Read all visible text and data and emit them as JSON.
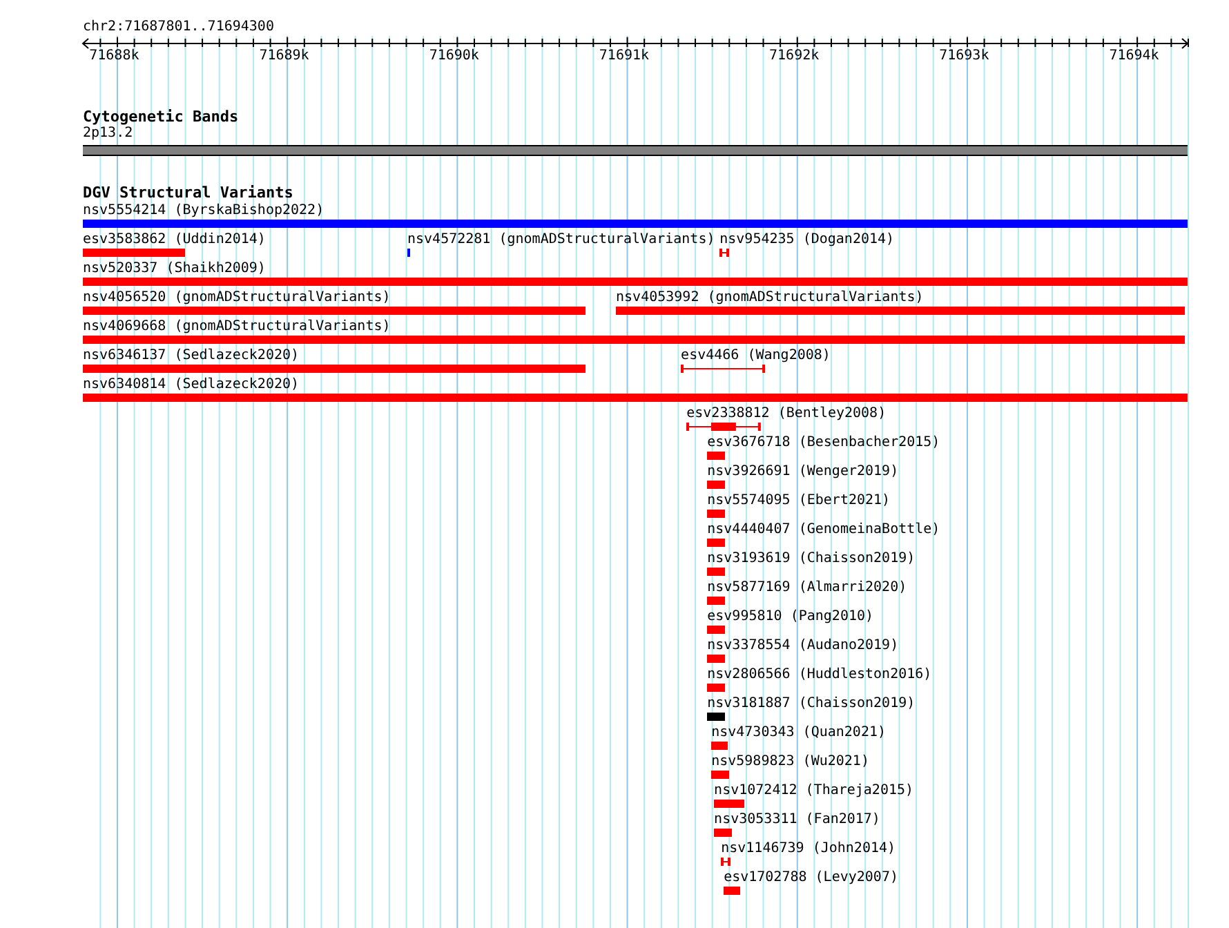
{
  "ruler": {
    "title": "chr2:71687801..71694300",
    "ticks": [
      {
        "label": "71688k"
      },
      {
        "label": "71689k"
      },
      {
        "label": "71690k"
      },
      {
        "label": "71691k"
      },
      {
        "label": "71692k"
      },
      {
        "label": "71693k"
      },
      {
        "label": "71694k"
      }
    ]
  },
  "cytoband_track": {
    "title": "Cytogenetic Bands",
    "band": {
      "label": "2p13.2",
      "color": "#808080"
    }
  },
  "variant_track": {
    "title": "DGV Structural Variants",
    "rows": [
      {
        "features": [
          {
            "label": "nsv5554214 (ByrskaBishop2022)",
            "kind": "bar",
            "color": "#0000ff"
          }
        ]
      },
      {
        "features": [
          {
            "label": "esv3583862 (Uddin2014)",
            "kind": "bar",
            "color": "#ff0000"
          },
          {
            "label": "nsv4572281 (gnomADStructuralVariants)",
            "kind": "bar",
            "color": "#0000ff"
          },
          {
            "label": "nsv954235 (Dogan2014)",
            "kind": "interval",
            "color": "#ff0000"
          }
        ]
      },
      {
        "features": [
          {
            "label": "nsv520337 (Shaikh2009)",
            "kind": "bar",
            "color": "#ff0000"
          }
        ]
      },
      {
        "features": [
          {
            "label": "nsv4056520 (gnomADStructuralVariants)",
            "kind": "bar",
            "color": "#ff0000"
          },
          {
            "label": "nsv4053992 (gnomADStructuralVariants)",
            "kind": "bar",
            "color": "#ff0000"
          }
        ]
      },
      {
        "features": [
          {
            "label": "nsv4069668 (gnomADStructuralVariants)",
            "kind": "bar",
            "color": "#ff0000"
          }
        ]
      },
      {
        "features": [
          {
            "label": "nsv6346137 (Sedlazeck2020)",
            "kind": "bar",
            "color": "#ff0000"
          },
          {
            "label": "esv4466 (Wang2008)",
            "kind": "interval",
            "color": "#ff0000"
          }
        ]
      },
      {
        "features": [
          {
            "label": "nsv6340814 (Sedlazeck2020)",
            "kind": "bar",
            "color": "#ff0000"
          }
        ]
      },
      {
        "features": [
          {
            "label": "esv2338812 (Bentley2008)",
            "kind": "interval",
            "color": "#ff0000"
          }
        ]
      },
      {
        "features": [
          {
            "label": "esv3676718 (Besenbacher2015)",
            "kind": "bar",
            "color": "#ff0000"
          }
        ]
      },
      {
        "features": [
          {
            "label": "nsv3926691 (Wenger2019)",
            "kind": "bar",
            "color": "#ff0000"
          }
        ]
      },
      {
        "features": [
          {
            "label": "nsv5574095 (Ebert2021)",
            "kind": "bar",
            "color": "#ff0000"
          }
        ]
      },
      {
        "features": [
          {
            "label": "nsv4440407 (GenomeinaBottle)",
            "kind": "bar",
            "color": "#ff0000"
          }
        ]
      },
      {
        "features": [
          {
            "label": "nsv3193619 (Chaisson2019)",
            "kind": "bar",
            "color": "#ff0000"
          }
        ]
      },
      {
        "features": [
          {
            "label": "nsv5877169 (Almarri2020)",
            "kind": "bar",
            "color": "#ff0000"
          }
        ]
      },
      {
        "features": [
          {
            "label": "esv995810 (Pang2010)",
            "kind": "bar",
            "color": "#ff0000"
          }
        ]
      },
      {
        "features": [
          {
            "label": "nsv3378554 (Audano2019)",
            "kind": "bar",
            "color": "#ff0000"
          }
        ]
      },
      {
        "features": [
          {
            "label": "nsv2806566 (Huddleston2016)",
            "kind": "bar",
            "color": "#ff0000"
          }
        ]
      },
      {
        "features": [
          {
            "label": "nsv3181887 (Chaisson2019)",
            "kind": "bar",
            "color": "#000000"
          }
        ]
      },
      {
        "features": [
          {
            "label": "nsv4730343 (Quan2021)",
            "kind": "bar",
            "color": "#ff0000"
          }
        ]
      },
      {
        "features": [
          {
            "label": "nsv5989823 (Wu2021)",
            "kind": "bar",
            "color": "#ff0000"
          }
        ]
      },
      {
        "features": [
          {
            "label": "nsv1072412 (Thareja2015)",
            "kind": "bar",
            "color": "#ff0000"
          }
        ]
      },
      {
        "features": [
          {
            "label": "nsv3053311 (Fan2017)",
            "kind": "bar",
            "color": "#ff0000"
          }
        ]
      },
      {
        "features": [
          {
            "label": "nsv1146739 (John2014)",
            "kind": "interval",
            "color": "#ff0000"
          }
        ]
      },
      {
        "features": [
          {
            "label": "esv1702788 (Levy2007)",
            "kind": "bar",
            "color": "#ff0000"
          }
        ]
      }
    ]
  }
}
